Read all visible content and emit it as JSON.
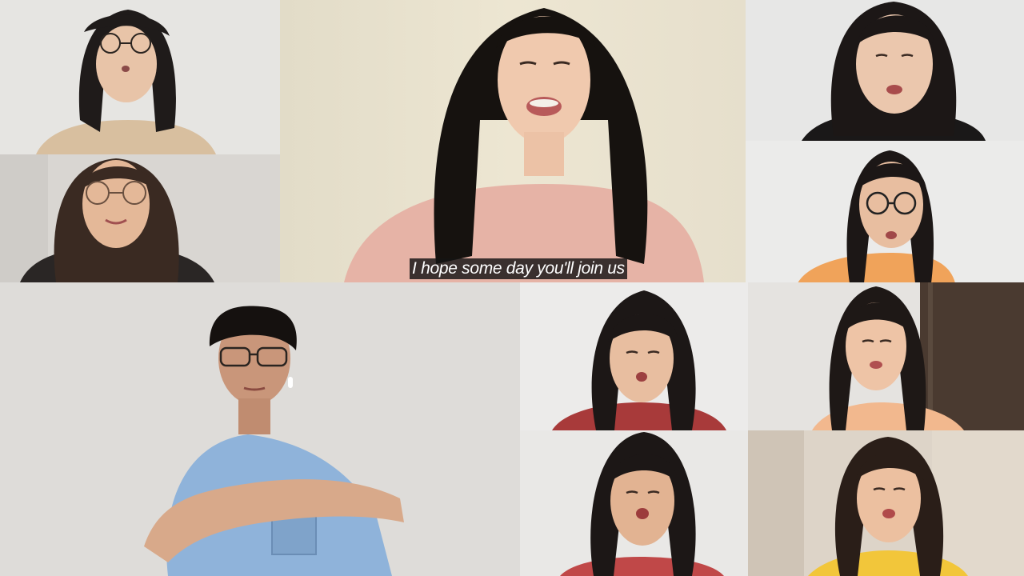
{
  "subtitle": {
    "text": "I hope some day you'll join us"
  }
}
